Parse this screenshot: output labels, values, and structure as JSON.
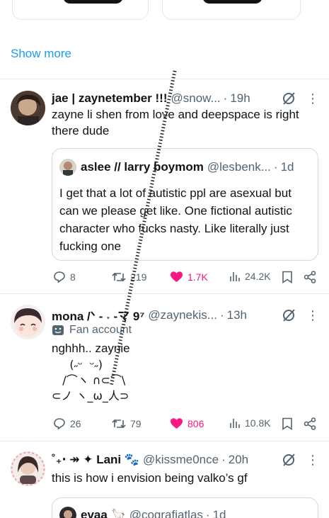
{
  "show_more": "Show more",
  "tweets": [
    {
      "name": "jae | zaynetember !!!",
      "handle": "@snow...",
      "time": "19h",
      "text": "zayne li shen from love and deepspace is right there dude",
      "quote": {
        "name": "aslee // larry boymom",
        "handle": "@lesbenk...",
        "time": "1d",
        "text": "I get that a lot of autistic ppl are asexual but can we please get like. One fictional autistic character who fucks nasty. Like literally just fucking one"
      },
      "replies": "8",
      "reposts": "219",
      "likes": "1.7K",
      "views": "24.2K"
    },
    {
      "name": "mona /ᐠ - ˕ -マ 9⁷",
      "handle": "@zaynekis...",
      "time": "13h",
      "badge": "Fan account",
      "text": "nghhh.. zaynie",
      "kaomoji": "     (˶ᵕ  ᵕ˶)\n   /⌒ヽ ∩⊂⌒\\\n⊂ノ ヽ_ω_人⊃",
      "replies": "26",
      "reposts": "79",
      "likes": "806",
      "views": "10.8K"
    },
    {
      "name": "˚₊‧ ↠ ✦ Lani 🐾",
      "handle": "@kissme0nce",
      "time": "20h",
      "text": "this is how i envision being valko’s gf",
      "quote": {
        "name": "evaa 🦙",
        "handle": "@cografiatlas",
        "time": "1d"
      }
    }
  ],
  "colors": {
    "accent": "#1d9bf0",
    "like": "#f91880",
    "muted": "#536471"
  }
}
